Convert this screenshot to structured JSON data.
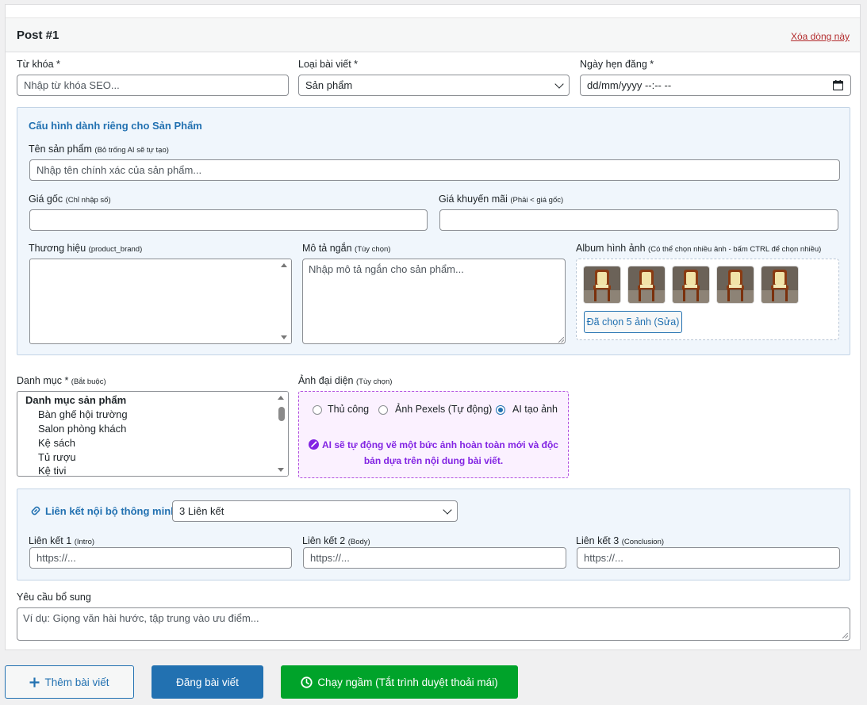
{
  "post": {
    "title": "Post #1",
    "delete_label": "Xóa dòng này"
  },
  "keyword": {
    "label": "Từ khóa *",
    "placeholder": "Nhập từ khóa SEO..."
  },
  "post_type": {
    "label": "Loại bài viết *",
    "value": "Sản phẩm"
  },
  "schedule": {
    "label": "Ngày hẹn đăng *",
    "value": "dd/mm/yyyy --:-- --"
  },
  "product_config": {
    "title": "Cấu hình dành riêng cho Sản Phẩm",
    "name_label": "Tên sản phẩm",
    "name_hint": "(Bỏ trống AI sẽ tự tạo)",
    "name_placeholder": "Nhập tên chính xác của sản phẩm...",
    "price_label": "Giá gốc",
    "price_hint": "(Chỉ nhập số)",
    "sale_label": "Giá khuyến mãi",
    "sale_hint": "(Phải < giá gốc)",
    "brand_label": "Thương hiệu",
    "brand_hint": "(product_brand)",
    "short_desc_label": "Mô tả ngắn",
    "short_desc_hint": "(Tùy chọn)",
    "short_desc_placeholder": "Nhập mô tả ngắn cho sản phẩm...",
    "album_label": "Album hình ảnh",
    "album_hint": "(Có thể chọn nhiều ảnh - bấm CTRL để chọn nhiều)",
    "album_count": 5,
    "album_button": "Đã chọn 5 ảnh (Sửa)"
  },
  "category": {
    "label": "Danh mục *",
    "hint": "(Bắt buộc)",
    "group": "Danh mục sản phẩm",
    "items": [
      "Bàn ghế hội trường",
      "Salon phòng khách",
      "Kệ sách",
      "Tủ rượu",
      "Kệ tivi"
    ]
  },
  "featured_image": {
    "label": "Ảnh đại diện",
    "hint": "(Tùy chọn)",
    "options": [
      "Thủ công",
      "Ảnh Pexels (Tự động)",
      "AI tạo ảnh"
    ],
    "selected": "AI tạo ảnh",
    "note_line1": "AI sẽ tự động vẽ một bức ảnh hoàn toàn mới và độc",
    "note_line2": "bản dựa trên nội dung bài viết."
  },
  "internal_links": {
    "title": "Liên kết nội bộ thông minh",
    "count_value": "3 Liên kết",
    "links": [
      {
        "label": "Liên kết 1",
        "hint": "(Intro)",
        "placeholder": "https://..."
      },
      {
        "label": "Liên kết 2",
        "hint": "(Body)",
        "placeholder": "https://..."
      },
      {
        "label": "Liên kết 3",
        "hint": "(Conclusion)",
        "placeholder": "https://..."
      }
    ]
  },
  "extra": {
    "label": "Yêu cầu bổ sung",
    "placeholder": "Ví dụ: Giọng văn hài hước, tập trung vào ưu điểm..."
  },
  "actions": {
    "add": "Thêm bài viết",
    "publish": "Đăng bài viết",
    "background": "Chạy ngầm (Tắt trình duyệt thoải mái)"
  },
  "colors": {
    "primary": "#2271b1",
    "success": "#00a32a",
    "danger": "#b32d2e",
    "ai": "#8224e3"
  }
}
